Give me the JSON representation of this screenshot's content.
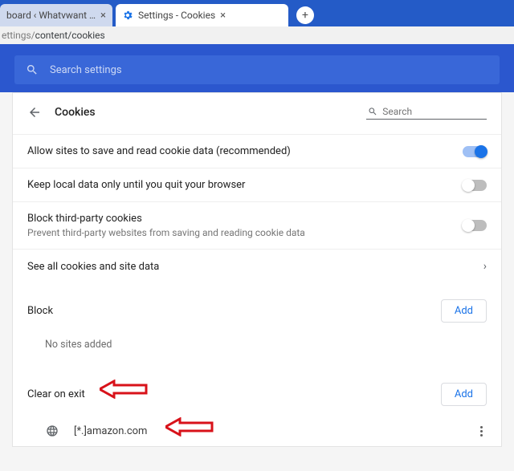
{
  "tabs": {
    "tab1": {
      "title": "board ‹ Whatvwant — Wor"
    },
    "tab2": {
      "title": "Settings - Cookies"
    }
  },
  "omnibox": {
    "gray": "ettings/",
    "dark": "content/cookies"
  },
  "banner": {
    "search_placeholder": "Search settings"
  },
  "header": {
    "title": "Cookies",
    "search_placeholder": "Search"
  },
  "rows": {
    "allow": "Allow sites to save and read cookie data (recommended)",
    "keep_local": "Keep local data only until you quit your browser",
    "block_third_title": "Block third-party cookies",
    "block_third_sub": "Prevent third-party websites from saving and reading cookie data",
    "see_all": "See all cookies and site data"
  },
  "sections": {
    "block": {
      "label": "Block",
      "add": "Add",
      "empty": "No sites added"
    },
    "clear_on_exit": {
      "label": "Clear on exit",
      "add": "Add",
      "site": "[*.]amazon.com"
    }
  }
}
